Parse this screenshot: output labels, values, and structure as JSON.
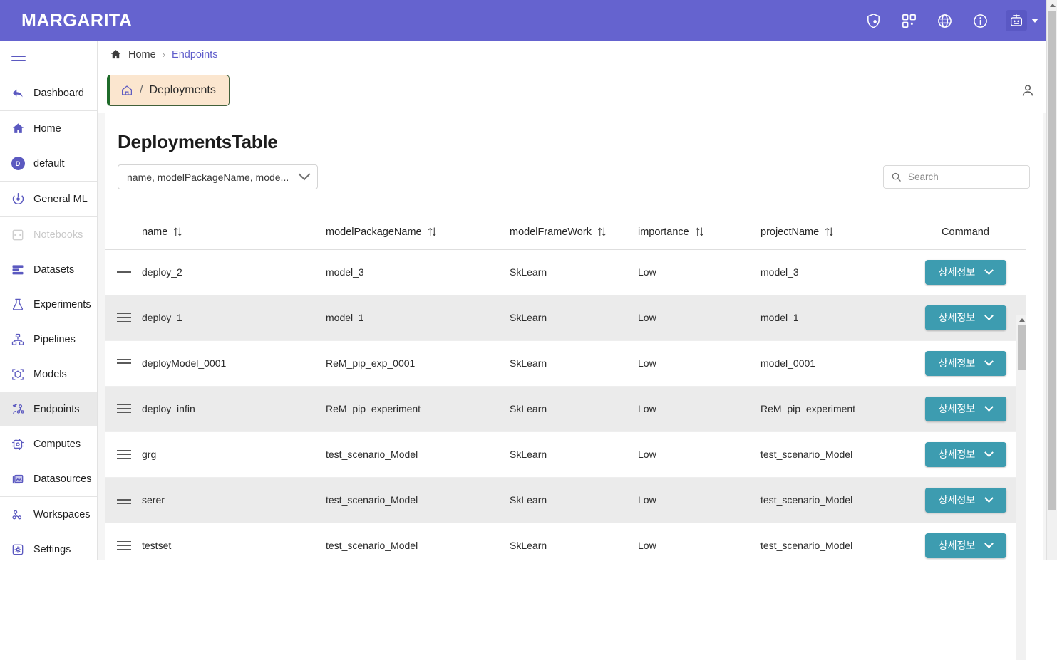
{
  "app": {
    "brand": "MARGARITA",
    "header_color": "#6563cf",
    "accent_teal": "#3d9cb0",
    "tab_bg": "#fbe6cf",
    "tab_border": "#41603a",
    "tab_accent": "#1f6b2a"
  },
  "topbar": {
    "icons": [
      {
        "name": "shield-lock-icon",
        "label": "Security"
      },
      {
        "name": "apps-grid-icon",
        "label": "Apps"
      },
      {
        "name": "globe-icon",
        "label": "Language"
      },
      {
        "name": "info-circle-icon",
        "label": "Info"
      }
    ],
    "avatar": {
      "name": "robot-avatar",
      "label": "Account"
    },
    "caret": "▾"
  },
  "sidebar": {
    "menu_toggle": "menu-icon",
    "groups": [
      {
        "items": [
          {
            "label": "Dashboard",
            "icon": "back-arrow-icon",
            "active": false,
            "disabled": false
          }
        ]
      },
      {
        "items": [
          {
            "label": "Home",
            "icon": "home-icon",
            "active": false,
            "disabled": false
          },
          {
            "label": "default",
            "icon": "default-badge-icon",
            "badge": "D",
            "active": false,
            "disabled": false
          }
        ]
      },
      {
        "items": [
          {
            "label": "General ML",
            "icon": "general-ml-icon",
            "active": false,
            "disabled": false
          }
        ]
      },
      {
        "items": [
          {
            "label": "Notebooks",
            "icon": "notebook-icon",
            "active": false,
            "disabled": true
          },
          {
            "label": "Datasets",
            "icon": "datasets-icon",
            "active": false,
            "disabled": false
          },
          {
            "label": "Experiments",
            "icon": "experiments-flask-icon",
            "active": false,
            "disabled": false
          },
          {
            "label": "Pipelines",
            "icon": "pipelines-icon",
            "active": false,
            "disabled": false
          },
          {
            "label": "Models",
            "icon": "models-cube-icon",
            "active": false,
            "disabled": false
          },
          {
            "label": "Endpoints",
            "icon": "endpoints-icon",
            "active": true,
            "disabled": false
          },
          {
            "label": "Computes",
            "icon": "computes-chip-icon",
            "active": false,
            "disabled": false
          },
          {
            "label": "Datasources",
            "icon": "datasources-icon",
            "active": false,
            "disabled": false
          }
        ]
      },
      {
        "items": [
          {
            "label": "Workspaces",
            "icon": "workspaces-icon",
            "active": false,
            "disabled": false
          },
          {
            "label": "Settings",
            "icon": "settings-gear-icon",
            "active": false,
            "disabled": false
          }
        ]
      }
    ]
  },
  "breadcrumb": {
    "home_icon": "home-icon",
    "home": "Home",
    "separator": "›",
    "current": "Endpoints"
  },
  "tab": {
    "icon": "home-outline-icon",
    "slash": "/",
    "label": "Deployments"
  },
  "user_button": {
    "icon": "person-icon"
  },
  "panel": {
    "title": "DeploymentsTable",
    "column_select": {
      "value": "name, modelPackageName, mode...",
      "chevron": "chevron-down-icon"
    },
    "search": {
      "placeholder": "Search",
      "value": "",
      "icon": "search-icon"
    }
  },
  "table": {
    "sort_icon": "sort-updown-icon",
    "drag_icon": "drag-handle-icon",
    "columns": [
      {
        "key": "name",
        "label": "name",
        "sortable": true
      },
      {
        "key": "modelPackageName",
        "label": "modelPackageName",
        "sortable": true
      },
      {
        "key": "modelFrameWork",
        "label": "modelFrameWork",
        "sortable": true
      },
      {
        "key": "importance",
        "label": "importance",
        "sortable": true
      },
      {
        "key": "projectName",
        "label": "projectName",
        "sortable": true
      },
      {
        "key": "Command",
        "label": "Command",
        "sortable": false
      }
    ],
    "action_button": {
      "label": "상세정보",
      "chevron": "chevron-down-icon"
    },
    "rows": [
      {
        "name": "deploy_2",
        "modelPackageName": "model_3",
        "modelFrameWork": "SkLearn",
        "importance": "Low",
        "projectName": "model_3"
      },
      {
        "name": "deploy_1",
        "modelPackageName": "model_1",
        "modelFrameWork": "SkLearn",
        "importance": "Low",
        "projectName": "model_1"
      },
      {
        "name": "deployModel_0001",
        "modelPackageName": "ReM_pip_exp_0001",
        "modelFrameWork": "SkLearn",
        "importance": "Low",
        "projectName": "model_0001"
      },
      {
        "name": "deploy_infin",
        "modelPackageName": "ReM_pip_experiment",
        "modelFrameWork": "SkLearn",
        "importance": "Low",
        "projectName": "ReM_pip_experiment"
      },
      {
        "name": "grg",
        "modelPackageName": "test_scenario_Model",
        "modelFrameWork": "SkLearn",
        "importance": "Low",
        "projectName": "test_scenario_Model"
      },
      {
        "name": "serer",
        "modelPackageName": "test_scenario_Model",
        "modelFrameWork": "SkLearn",
        "importance": "Low",
        "projectName": "test_scenario_Model"
      },
      {
        "name": "testset",
        "modelPackageName": "test_scenario_Model",
        "modelFrameWork": "SkLearn",
        "importance": "Low",
        "projectName": "test_scenario_Model"
      }
    ]
  }
}
